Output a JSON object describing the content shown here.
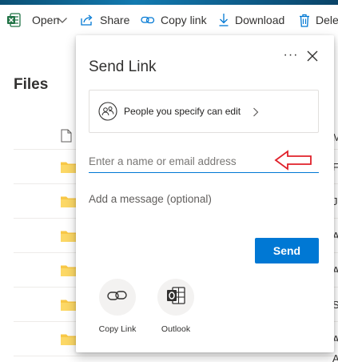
{
  "toolbar": {
    "open_label": "Open",
    "share_label": "Share",
    "copy_link_label": "Copy link",
    "download_label": "Download",
    "delete_label": "Dele"
  },
  "files": {
    "title": "Files",
    "edge_letters": [
      "M",
      "F",
      "Ja",
      "A",
      "A",
      "S",
      "A",
      "A"
    ]
  },
  "dialog": {
    "title": "Send Link",
    "more_label": "···",
    "permission_text": "People you specify can edit",
    "email_placeholder": "Enter a name or email address",
    "message_placeholder": "Add a message (optional)",
    "send_label": "Send",
    "options": [
      {
        "label": "Copy Link",
        "icon": "link-icon"
      },
      {
        "label": "Outlook",
        "icon": "outlook-icon"
      }
    ]
  },
  "colors": {
    "accent": "#0078d4",
    "folder": "#f8c847",
    "annotation_arrow": "#e0202a",
    "excel_green": "#217346"
  }
}
